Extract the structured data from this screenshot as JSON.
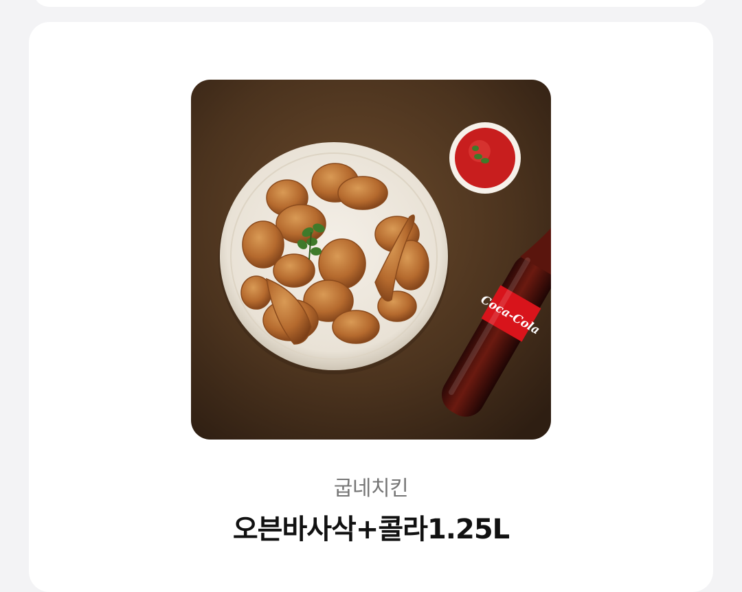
{
  "product": {
    "brand": "굽네치킨",
    "name": "오븐바사삭+콜라1.25L",
    "image_icon": "fried-chicken-with-cola-photo",
    "bottle_text": "Coca-Cola"
  },
  "colors": {
    "background": "#f3f3f5",
    "card": "#ffffff",
    "brand_text": "#757575",
    "name_text": "#111111"
  }
}
